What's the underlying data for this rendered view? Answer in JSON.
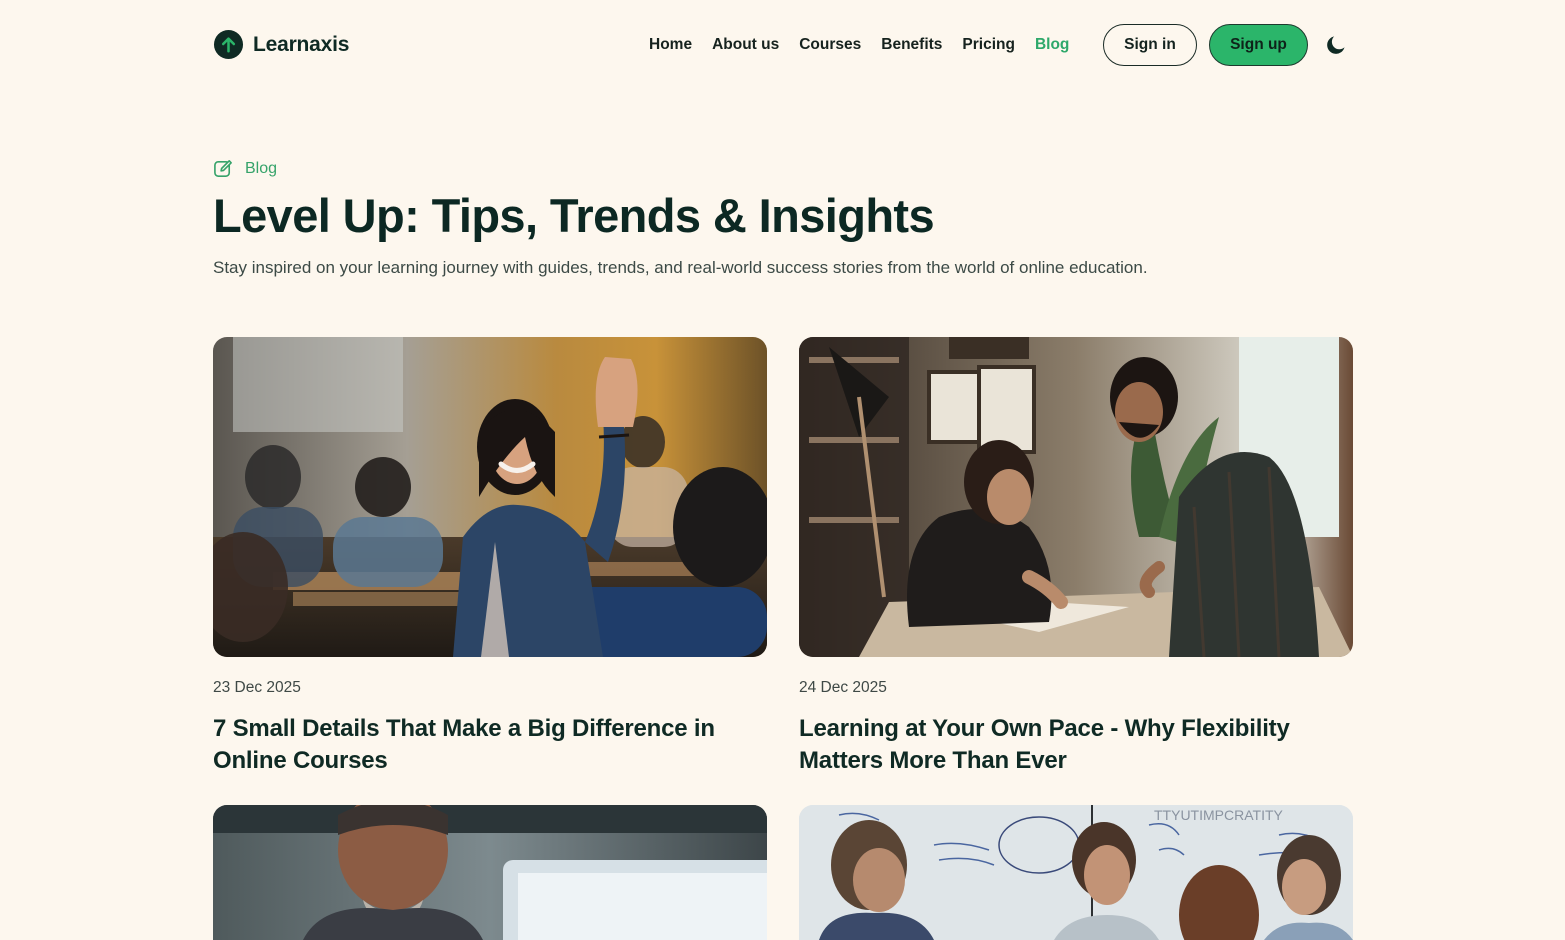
{
  "brand": {
    "name": "Learnaxis",
    "logo_icon": "arrow-up-circle-icon",
    "primary_color": "#0f2a24",
    "accent_color": "#2bb56a"
  },
  "nav": {
    "items": [
      {
        "label": "Home",
        "active": false
      },
      {
        "label": "About us",
        "active": false
      },
      {
        "label": "Courses",
        "active": false
      },
      {
        "label": "Benefits",
        "active": false
      },
      {
        "label": "Pricing",
        "active": false
      },
      {
        "label": "Blog",
        "active": true
      }
    ],
    "sign_in_label": "Sign in",
    "sign_up_label": "Sign up",
    "theme_toggle_icon": "moon-icon"
  },
  "hero": {
    "eyebrow_icon": "edit-icon",
    "eyebrow": "Blog",
    "title": "Level Up: Tips, Trends & Insights",
    "subtitle": "Stay inspired on your learning journey with guides, trends, and real-world success stories from the world of online education."
  },
  "posts": [
    {
      "date": "23 Dec 2025",
      "title": "7 Small Details That Make a Big Difference in Online Courses"
    },
    {
      "date": "24 Dec 2025",
      "title": "Learning at Your Own Pace - Why Flexibility Matters More Than Ever"
    },
    {
      "date": "",
      "title": ""
    },
    {
      "date": "",
      "title": ""
    }
  ]
}
